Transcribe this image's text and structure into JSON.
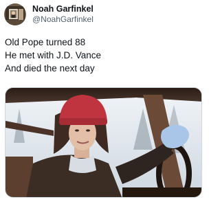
{
  "author": {
    "display_name": "Noah Garfinkel",
    "handle": "@NoahGarfinkel",
    "avatar_icon": "profile-photo"
  },
  "tweet": {
    "lines": [
      "Old Pope turned 88",
      "He met with J.D. Vance",
      "And died the next day"
    ]
  },
  "media": {
    "description_icon": "movie-still-woman-driving-car",
    "colors": {
      "hat": "#c0343f",
      "glove": "#a9c6e8",
      "snow": "#dfe6ee",
      "interior": "#3a2a22"
    }
  }
}
